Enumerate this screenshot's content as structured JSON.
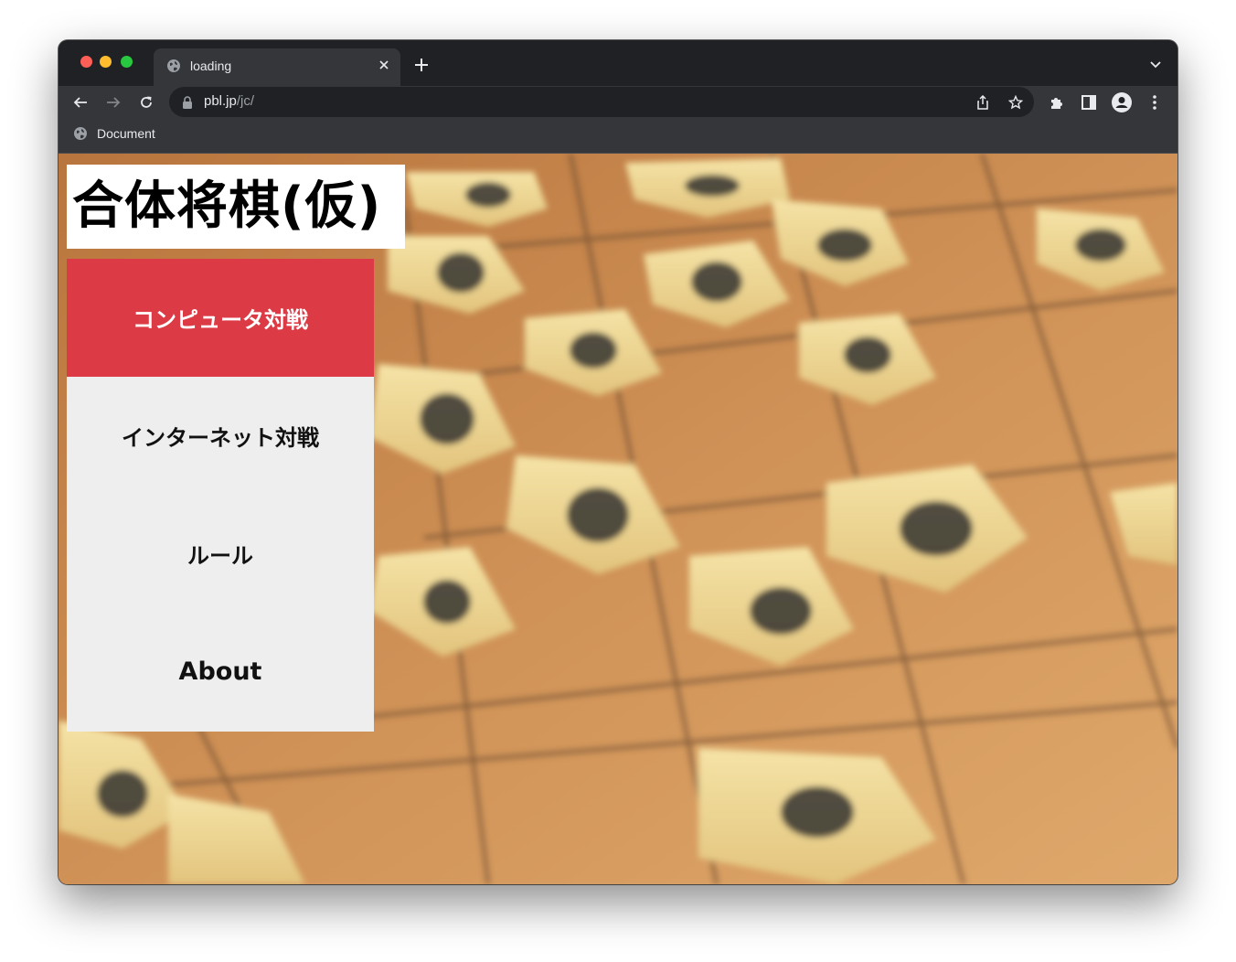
{
  "browser": {
    "tab": {
      "title": "loading"
    },
    "address_bar": {
      "host": "pbl.jp",
      "path": "/jc/"
    },
    "bookmarks": [
      {
        "label": "Document"
      }
    ]
  },
  "page": {
    "logo": "合体将棋(仮)",
    "menu": [
      {
        "label": "コンピュータ対戦",
        "active": true
      },
      {
        "label": "インターネット対戦",
        "active": false
      },
      {
        "label": "ルール",
        "active": false
      },
      {
        "label": "About",
        "active": false
      }
    ],
    "background": "blurred photo of shogi pieces on a wooden board"
  },
  "colors": {
    "accent": "#dc3a44",
    "menu_bg": "#eeeeee",
    "logo_bg": "#ffffff",
    "chrome_dark": "#202124",
    "chrome_mid": "#35363a"
  }
}
